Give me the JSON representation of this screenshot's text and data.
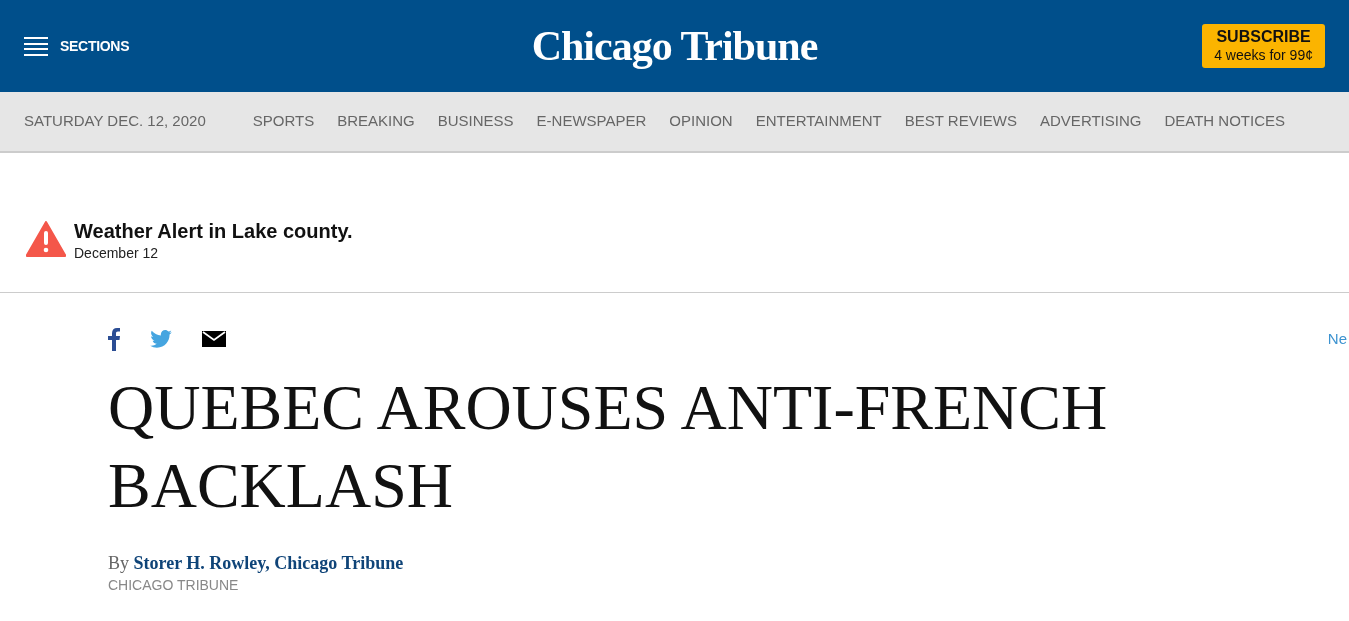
{
  "header": {
    "menu_label": "SECTIONS",
    "logo": "Chicago Tribune",
    "subscribe": {
      "title": "SUBSCRIBE",
      "offer": "4 weeks for 99¢"
    }
  },
  "nav": {
    "date": "SATURDAY DEC. 12, 2020",
    "links": [
      "SPORTS",
      "BREAKING",
      "BUSINESS",
      "E-NEWSPAPER",
      "OPINION",
      "ENTERTAINMENT",
      "BEST REVIEWS",
      "ADVERTISING",
      "DEATH NOTICES"
    ]
  },
  "alert": {
    "title": "Weather Alert in Lake county.",
    "date": "December 12"
  },
  "share": [
    {
      "kind": "facebook"
    },
    {
      "kind": "twitter"
    },
    {
      "kind": "email"
    }
  ],
  "side_link": "Ne",
  "article": {
    "headline": "QUEBEC AROUSES ANTI-FRENCH BACKLASH",
    "byline_prefix": "By",
    "author": "Storer H. Rowley, Chicago Tribune",
    "source": "CHICAGO TRIBUNE"
  }
}
